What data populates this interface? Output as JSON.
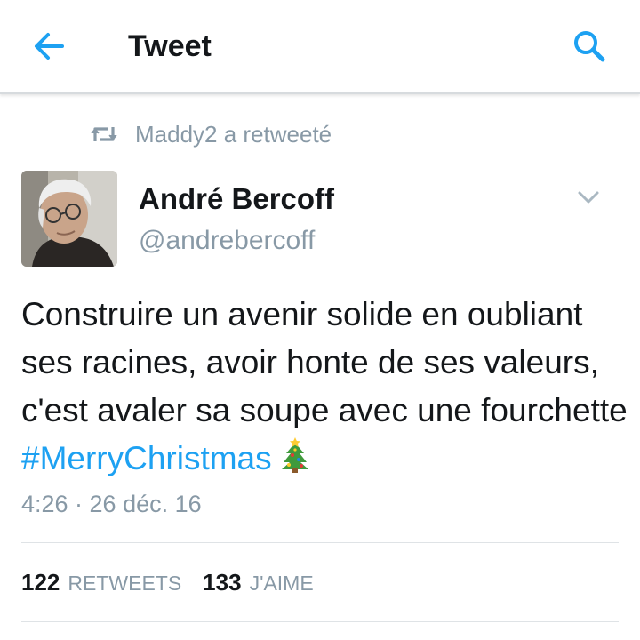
{
  "header": {
    "title": "Tweet",
    "back_icon": "arrow-left-icon",
    "search_icon": "search-icon",
    "accent_color": "#1da1f2"
  },
  "retweet_context": {
    "icon": "retweet-icon",
    "label": "Maddy2 a retweeté"
  },
  "tweet": {
    "author_name": "André Bercoff",
    "author_handle": "@andrebercoff",
    "avatar": "avatar-photo",
    "menu_icon": "chevron-down-icon",
    "text_before": "Construire un avenir solide en oubliant ses racines, avoir honte de ses valeurs, c'est avaler sa soupe avec une fourchette ",
    "hashtag": "#MerryChristmas",
    "emoji": "christmas-tree-icon",
    "timestamp": "4:26 · 26 déc. 16"
  },
  "stats": {
    "retweets_count": "122",
    "retweets_label": "RETWEETS",
    "likes_count": "133",
    "likes_label": "J'AIME"
  }
}
